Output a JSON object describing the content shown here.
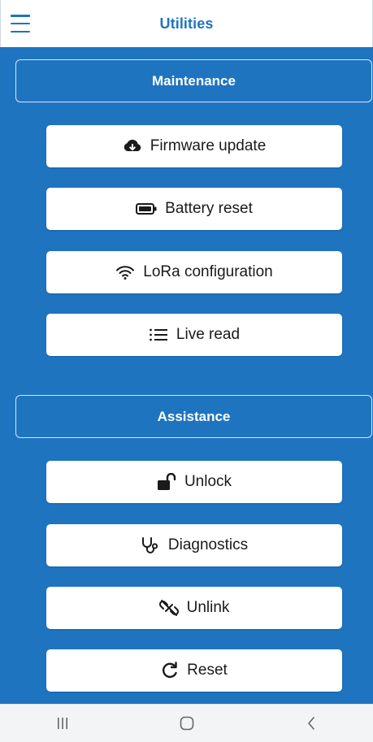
{
  "appbar": {
    "title": "Utilities",
    "menu_icon": "hamburger-menu-icon"
  },
  "sections": {
    "maintenance": {
      "title": "Maintenance",
      "buttons": [
        {
          "label": "Firmware update",
          "icon": "cloud-download-icon"
        },
        {
          "label": "Battery reset",
          "icon": "battery-icon"
        },
        {
          "label": "LoRa configuration",
          "icon": "wifi-icon"
        },
        {
          "label": "Live read",
          "icon": "list-icon"
        }
      ]
    },
    "assistance": {
      "title": "Assistance",
      "buttons": [
        {
          "label": "Unlock",
          "icon": "unlock-icon"
        },
        {
          "label": "Diagnostics",
          "icon": "stethoscope-icon"
        },
        {
          "label": "Unlink",
          "icon": "unlink-icon"
        },
        {
          "label": "Reset",
          "icon": "refresh-icon"
        }
      ]
    }
  },
  "system_nav": {
    "recent_icon": "recent-apps-icon",
    "home_icon": "home-icon",
    "back_icon": "back-icon"
  },
  "colors": {
    "primary": "#1f74c0",
    "button_bg": "#ffffff",
    "text_dark": "#1a1a1a",
    "nav_bg": "#f2f4f6"
  }
}
